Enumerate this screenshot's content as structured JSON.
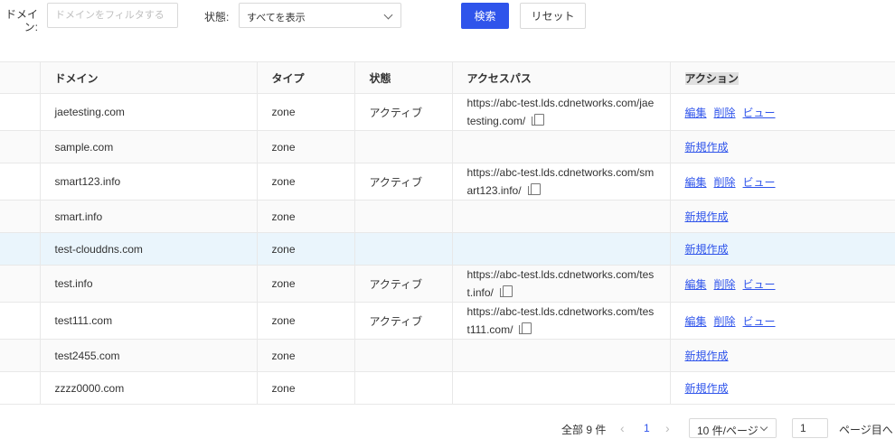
{
  "filters": {
    "domain_label": "ドメイン:",
    "domain_placeholder": "ドメインをフィルタする",
    "status_label": "状態:",
    "status_value": "すべてを表示",
    "search_button": "検索",
    "reset_button": "リセット"
  },
  "table": {
    "headers": [
      "ドメイン",
      "タイプ",
      "状態",
      "アクセスパス",
      "アクション"
    ],
    "rows": [
      {
        "domain": "jaetesting.com",
        "type": "zone",
        "status": "アクティブ",
        "path": "https://abc-test.lds.cdnetworks.com/jaetesting.com/",
        "actions": [
          "編集",
          "削除",
          "ビュー"
        ]
      },
      {
        "domain": "sample.com",
        "type": "zone",
        "status": "",
        "path": "",
        "actions": [
          "新規作成"
        ]
      },
      {
        "domain": "smart123.info",
        "type": "zone",
        "status": "アクティブ",
        "path": "https://abc-test.lds.cdnetworks.com/smart123.info/",
        "actions": [
          "編集",
          "削除",
          "ビュー"
        ]
      },
      {
        "domain": "smart.info",
        "type": "zone",
        "status": "",
        "path": "",
        "actions": [
          "新規作成"
        ]
      },
      {
        "domain": "test-clouddns.com",
        "type": "zone",
        "status": "",
        "path": "",
        "actions": [
          "新規作成"
        ]
      },
      {
        "domain": "test.info",
        "type": "zone",
        "status": "アクティブ",
        "path": "https://abc-test.lds.cdnetworks.com/test.info/",
        "actions": [
          "編集",
          "削除",
          "ビュー"
        ]
      },
      {
        "domain": "test111.com",
        "type": "zone",
        "status": "アクティブ",
        "path": "https://abc-test.lds.cdnetworks.com/test111.com/",
        "actions": [
          "編集",
          "削除",
          "ビュー"
        ]
      },
      {
        "domain": "test2455.com",
        "type": "zone",
        "status": "",
        "path": "",
        "actions": [
          "新規作成"
        ]
      },
      {
        "domain": "zzzz0000.com",
        "type": "zone",
        "status": "",
        "path": "",
        "actions": [
          "新規作成"
        ]
      }
    ]
  },
  "pagination": {
    "total": "全部 9 件",
    "current_page": "1",
    "page_size": "10 件/ページ",
    "jump_value": "1",
    "jump_label": "ページ目へ"
  },
  "colors": {
    "primary": "#2f54eb",
    "highlight_row": "#eaf5fc"
  },
  "icons": {
    "copy": "copy-icon",
    "prev": "chevron-left-icon",
    "next": "chevron-right-icon",
    "dropdown": "chevron-down-icon"
  }
}
